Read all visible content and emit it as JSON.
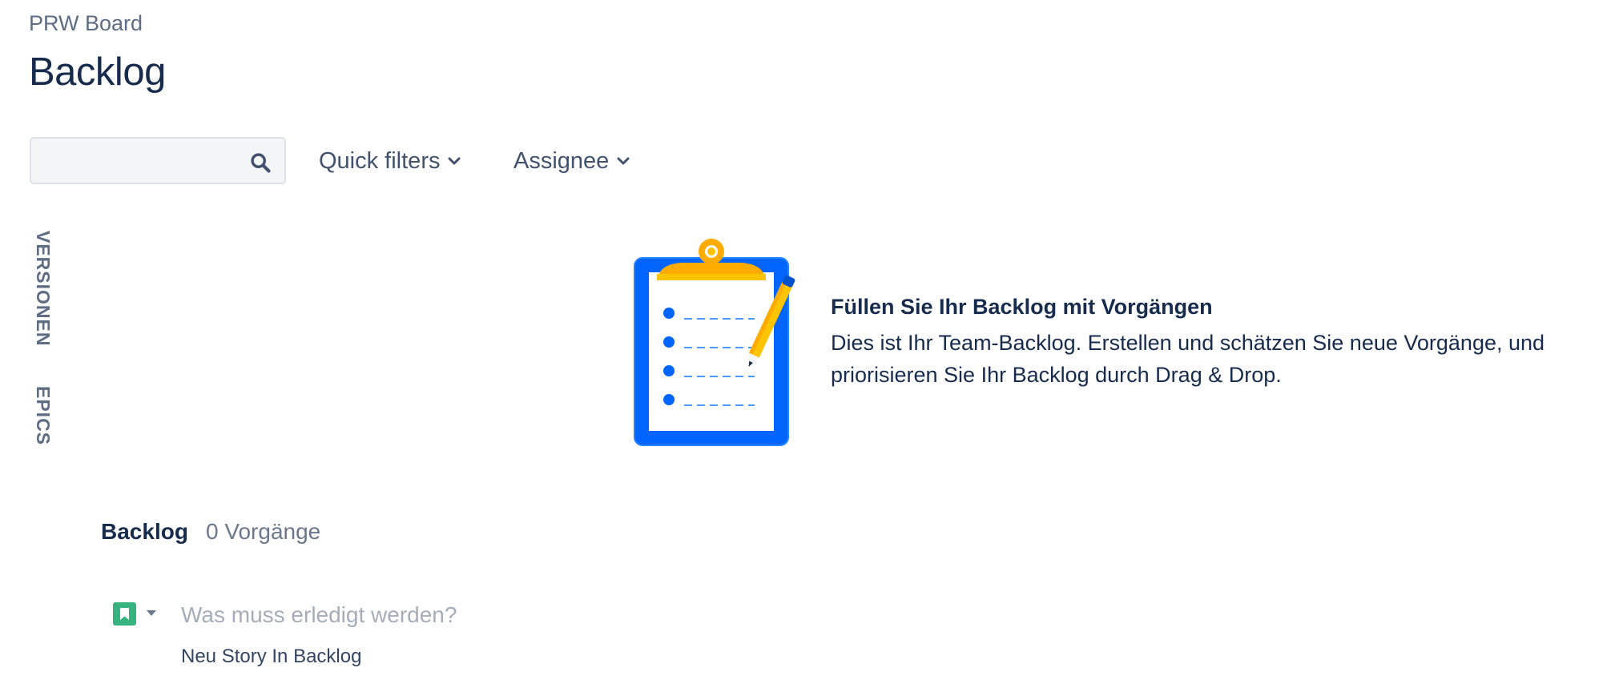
{
  "header": {
    "breadcrumb": "PRW Board",
    "title": "Backlog"
  },
  "toolbar": {
    "search": {
      "value": "",
      "placeholder": "",
      "icon": "search-icon"
    },
    "quick_filters_label": "Quick filters",
    "assignee_label": "Assignee",
    "dropdown_icon": "chevron-down-icon"
  },
  "side_tabs": {
    "versions": "VERSIONEN",
    "epics": "EPICS"
  },
  "empty_state": {
    "illustration": "clipboard-checklist-illustration",
    "heading": "Füllen Sie Ihr Backlog mit Vorgängen",
    "text": "Dies ist Ihr Team-Backlog. Erstellen und schätzen Sie neue Vorgänge, und priorisieren Sie Ihr Backlog durch Drag & Drop."
  },
  "backlog": {
    "title": "Backlog",
    "count": "0 Vorgänge",
    "create": {
      "placeholder": "Was muss erledigt werden?",
      "value": "",
      "issue_type_icon": "story-icon"
    },
    "suggestion": "Neu Story In Backlog"
  },
  "colors": {
    "primary_text": "#172B4D",
    "secondary_text": "#5E6C84",
    "clipboard_blue": "#0065FF",
    "clip_yellow": "#FFAB00",
    "story_green": "#36B37E"
  }
}
